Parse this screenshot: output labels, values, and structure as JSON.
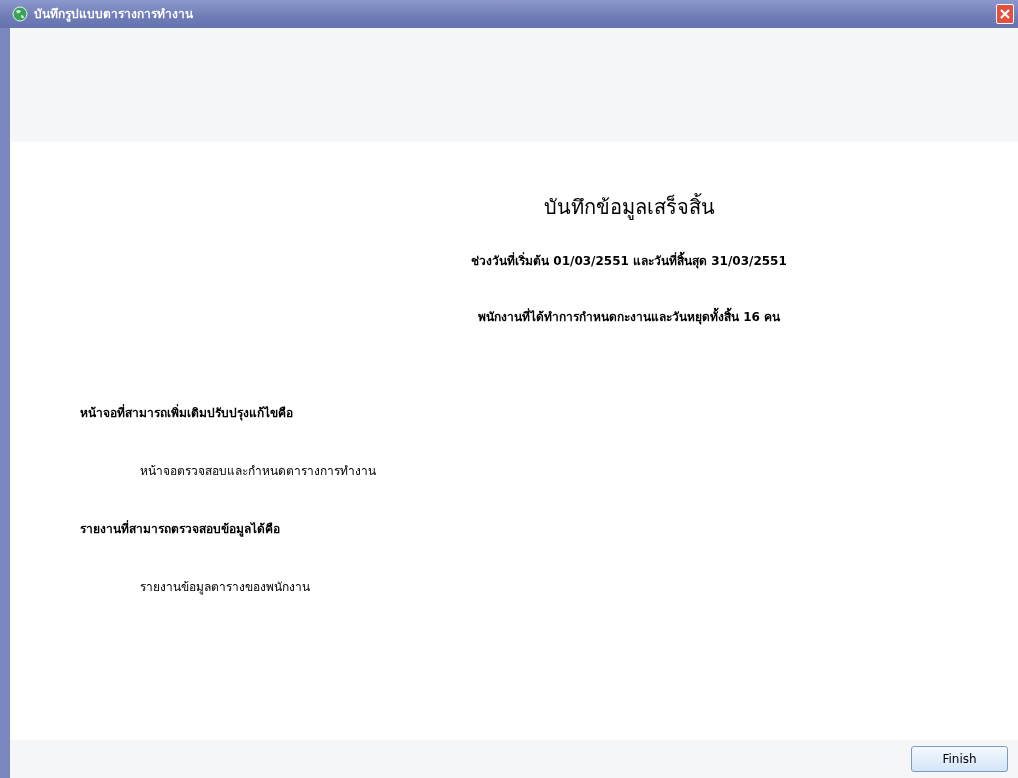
{
  "window": {
    "title": "บันทึกรูปแบบตารางการทำงาน"
  },
  "heading": "บันทึกข้อมูลเสร็จสิ้น",
  "summary": [
    "ช่วงวันที่เริ่มต้น 01/03/2551 และวันที่สิ้นสุด 31/03/2551",
    "พนักงานที่ได้ทำการกำหนดกะงานและวันหยุดทั้งสิ้น 16 คน"
  ],
  "sections": [
    {
      "title": "หน้าจอที่สามารถเพิ่มเติมปรับปรุงแก้ไขคือ",
      "items": [
        "หน้าจอตรวจสอบและกำหนดตารางการทำงาน"
      ]
    },
    {
      "title": "รายงานที่สามารถตรวจสอบข้อมูลได้คือ",
      "items": [
        "รายงานข้อมูลตารางของพนักงาน"
      ]
    }
  ],
  "buttons": [
    "Finish"
  ]
}
